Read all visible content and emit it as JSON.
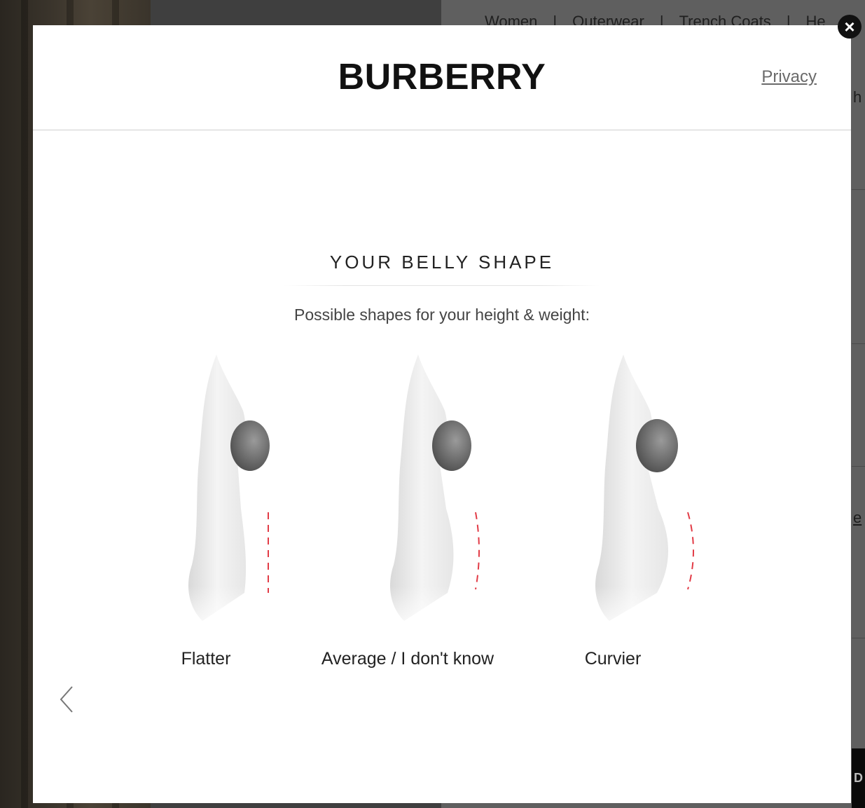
{
  "background": {
    "breadcrumb": [
      "Women",
      "|",
      "Outerwear",
      "|",
      "Trench Coats",
      "|",
      "He"
    ],
    "fragments": [
      "h",
      "e"
    ],
    "dark_button_letter": "D"
  },
  "modal": {
    "logo": "BURBERRY",
    "privacy_link": "Privacy",
    "close_icon": "×",
    "title": "YOUR BELLY SHAPE",
    "subtitle": "Possible shapes for your height & weight:",
    "options": [
      {
        "label": "Flatter",
        "icon": "flatter-belly-figure"
      },
      {
        "label": "Average / I don't know",
        "icon": "average-belly-figure"
      },
      {
        "label": "Curvier",
        "icon": "curvier-belly-figure"
      }
    ],
    "back_icon": "chevron-left-icon",
    "colors": {
      "accent_dash": "#e23b46",
      "text": "#222222"
    }
  }
}
